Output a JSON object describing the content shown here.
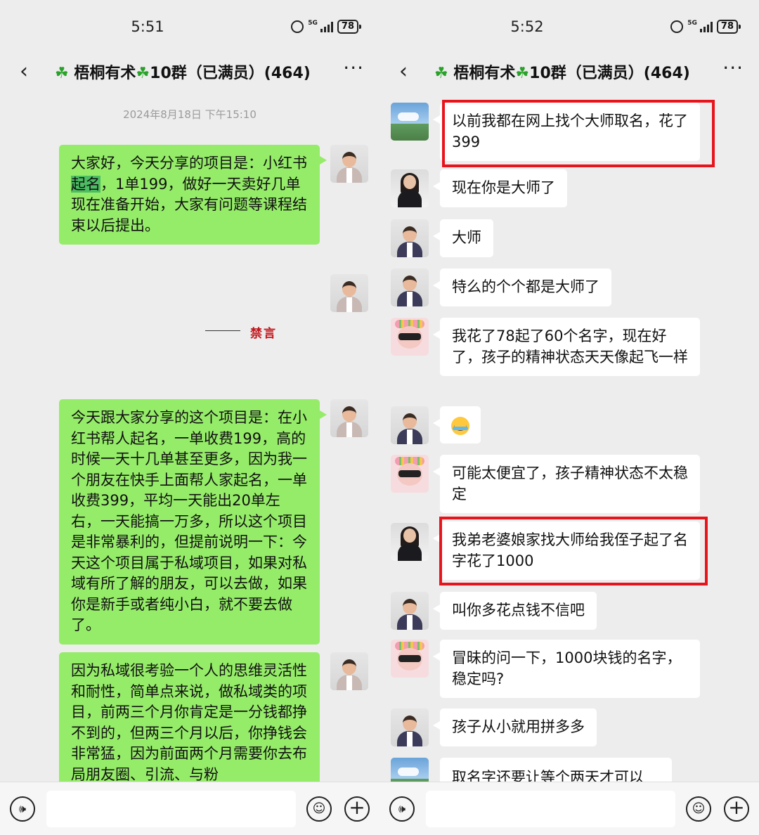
{
  "colors": {
    "chat_background": "#ededed",
    "own_bubble": "#95ec69",
    "other_bubble": "#ffffff",
    "highlight_box": "#e8141c",
    "muted_text": "#c0161c"
  },
  "left": {
    "status": {
      "time": "5:51",
      "network": "5G",
      "battery": "78"
    },
    "header": {
      "back_icon": "‹",
      "clover": "☘",
      "title_name": "梧桐有术",
      "title_suffix": "10群（已满员）(464)",
      "more_icon": "···"
    },
    "timestamp": "2024年8月18日 下午15:10",
    "messages": [
      {
        "pre": "大家好，今天分享的项目是：小红书",
        "highlight": "起名",
        "post": "，1单199，做好一天卖好几单\n现在准备开始，大家有问题等课程结束以后提出。"
      },
      {
        "text": "今天跟大家分享的这个项目是：在小红书帮人起名，一单收费199，高的时候一天十几单甚至更多，因为我一个朋友在快手上面帮人家起名，一单收费399，平均一天能出20单左右，一天能搞一万多，所以这个项目是非常暴利的，但提前说明一下：今天这个项目属于私域项目，如果对私域有所了解的朋友，可以去做，如果你是新手或者纯小白，就不要去做了。"
      },
      {
        "text": "因为私域很考验一个人的思维灵活性和耐性，简单点来说，做私域类的项目，前两三个月你肯定是一分钱都挣不到的，但两三个月以后，你挣钱会非常猛，因为前面两个月需要你去布局朋友圈、引流、与粉"
      }
    ],
    "muted_label": "禁言"
  },
  "right": {
    "status": {
      "time": "5:52",
      "network": "5G",
      "battery": "78"
    },
    "header": {
      "back_icon": "‹",
      "clover": "☘",
      "title_name": "梧桐有术",
      "title_suffix": "10群（已满员）(464)",
      "more_icon": "···"
    },
    "messages": [
      {
        "text": "以前我都在网上找个大师取名，花了399"
      },
      {
        "text": "现在你是大师了"
      },
      {
        "text": "大师"
      },
      {
        "text": "特么的个个都是大师了"
      },
      {
        "text": "我花了78起了60个名字，现在好了，孩子的精神状态天天像起飞一样"
      },
      {
        "emoji": "crying-laughing-emoji"
      },
      {
        "text": "可能太便宜了，孩子精神状态不太稳定"
      },
      {
        "text": "我弟老婆娘家找大师给我侄子起了名字花了1000"
      },
      {
        "text": "叫你多花点钱不信吧"
      },
      {
        "text": "冒昧的问一下，1000块钱的名字，稳定吗?"
      },
      {
        "text": "孩子从小就用拼多多"
      },
      {
        "text": "取名字还要让等个两天才可以"
      }
    ]
  },
  "input_bar": {
    "voice_icon": "🕪",
    "emoji_icon": "☺",
    "plus_icon": "+"
  }
}
